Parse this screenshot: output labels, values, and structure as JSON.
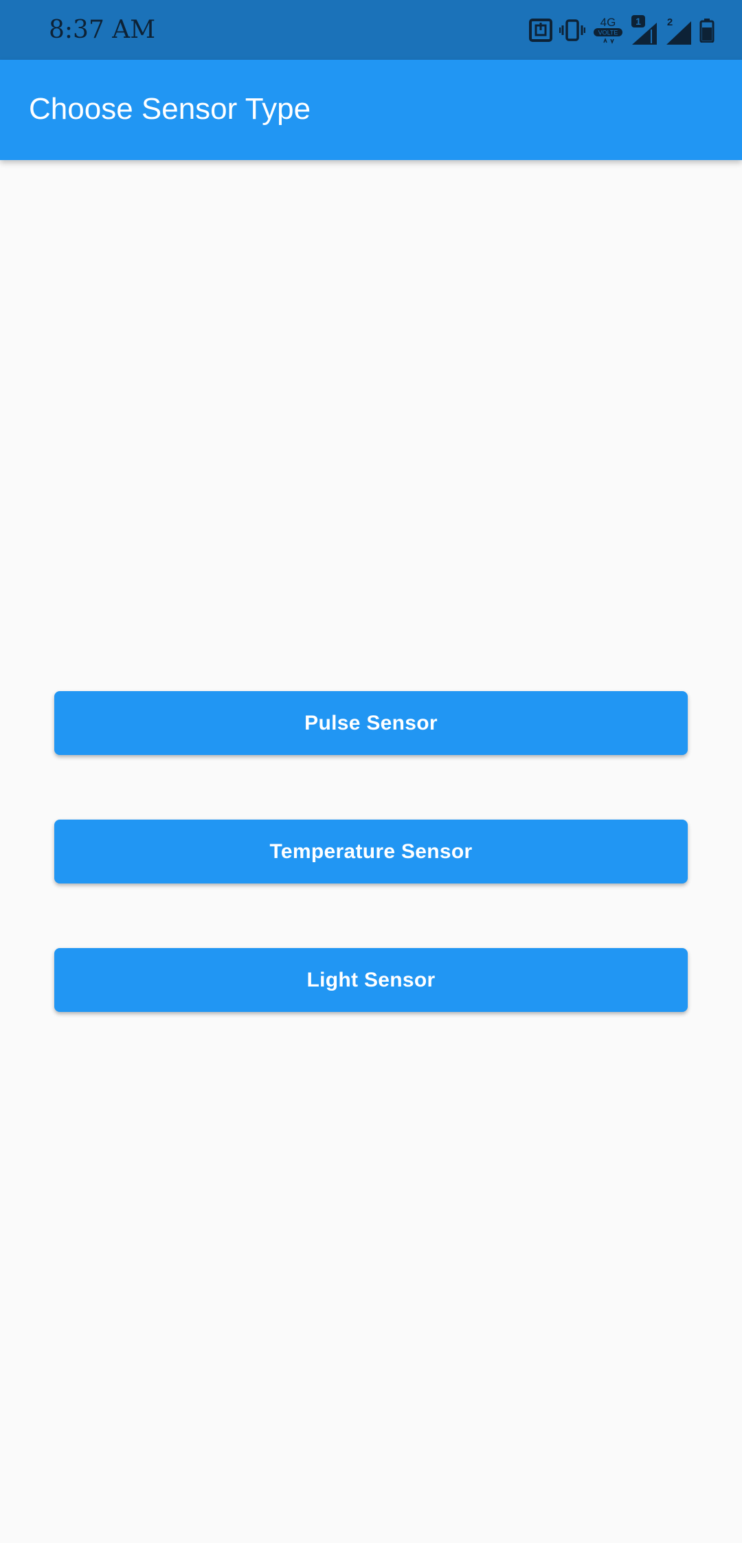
{
  "status_bar": {
    "time": "8:37 AM",
    "network_label": "4G",
    "volte_label": "VOLTE",
    "sim1_label": "1",
    "sim2_label": "2",
    "icons": [
      "nfc-icon",
      "vibrate-icon",
      "network-4g-volte-icon",
      "signal-sim1-icon",
      "signal-sim2-icon",
      "battery-icon"
    ],
    "color": "#1b72b9"
  },
  "app_bar": {
    "title": "Choose Sensor Type",
    "color": "#2196f3"
  },
  "sensors": {
    "buttons": [
      {
        "label": "Pulse Sensor"
      },
      {
        "label": "Temperature Sensor"
      },
      {
        "label": "Light Sensor"
      }
    ],
    "button_color": "#2196f3"
  }
}
